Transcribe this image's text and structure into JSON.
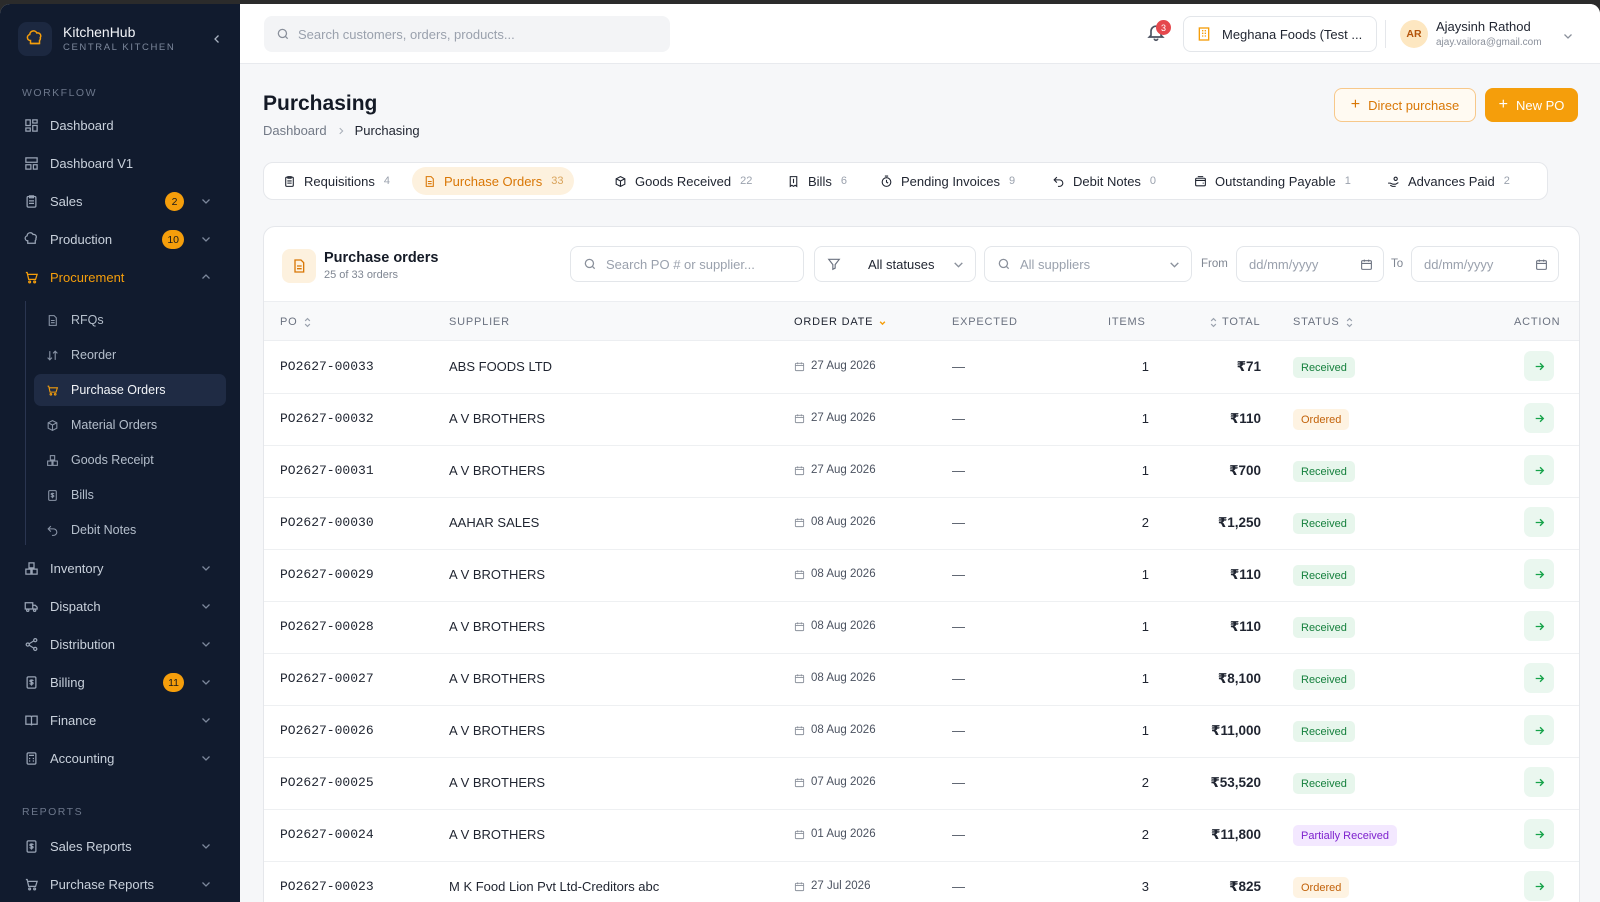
{
  "app": {
    "name": "KitchenHub",
    "subtitle": "CENTRAL KITCHEN"
  },
  "sidebar": {
    "workflow_label": "WORKFLOW",
    "reports_label": "REPORTS",
    "items": [
      {
        "label": "Dashboard",
        "icon": "grid-icon"
      },
      {
        "label": "Dashboard V1",
        "icon": "layout-icon"
      },
      {
        "label": "Sales",
        "icon": "clipboard-icon",
        "badge": "2"
      },
      {
        "label": "Production",
        "icon": "chef-hat-icon",
        "badge": "10"
      },
      {
        "label": "Procurement",
        "icon": "cart-icon",
        "active": true
      },
      {
        "label": "Inventory",
        "icon": "boxes-icon"
      },
      {
        "label": "Dispatch",
        "icon": "truck-icon"
      },
      {
        "label": "Distribution",
        "icon": "share-icon"
      },
      {
        "label": "Billing",
        "icon": "dollar-doc-icon",
        "badge": "11"
      },
      {
        "label": "Finance",
        "icon": "book-icon"
      },
      {
        "label": "Accounting",
        "icon": "calculator-icon"
      }
    ],
    "procurement_sub": [
      {
        "label": "RFQs",
        "icon": "doc-icon"
      },
      {
        "label": "Reorder",
        "icon": "sort-icon"
      },
      {
        "label": "Purchase Orders",
        "icon": "cart-icon",
        "active": true
      },
      {
        "label": "Material Orders",
        "icon": "package-icon"
      },
      {
        "label": "Goods Receipt",
        "icon": "boxes-icon"
      },
      {
        "label": "Bills",
        "icon": "dollar-doc-icon"
      },
      {
        "label": "Debit Notes",
        "icon": "undo-icon"
      }
    ],
    "reports": [
      {
        "label": "Sales Reports",
        "icon": "dollar-doc-icon"
      },
      {
        "label": "Purchase Reports",
        "icon": "cart-icon"
      }
    ]
  },
  "topbar": {
    "search_placeholder": "Search customers, orders, products...",
    "notifications": "3",
    "org": "Meghana Foods (Test ...",
    "user_initials": "AR",
    "user_name": "Ajaysinh Rathod",
    "user_email": "ajay.vailora@gmail.com"
  },
  "header": {
    "title": "Purchasing",
    "breadcrumb": [
      "Dashboard",
      "Purchasing"
    ],
    "direct_purchase": "Direct purchase",
    "new_po": "New PO"
  },
  "tabs": [
    {
      "label": "Requisitions",
      "count": "4",
      "icon": "clipboard-icon"
    },
    {
      "label": "Purchase Orders",
      "count": "33",
      "icon": "doc-icon",
      "active": true
    },
    {
      "label": "Goods Received",
      "count": "22",
      "icon": "package-icon"
    },
    {
      "label": "Bills",
      "count": "6",
      "icon": "receipt-icon"
    },
    {
      "label": "Pending Invoices",
      "count": "9",
      "icon": "hourglass-icon"
    },
    {
      "label": "Debit Notes",
      "count": "0",
      "icon": "undo-icon"
    },
    {
      "label": "Outstanding Payable",
      "count": "1",
      "icon": "wallet-icon"
    },
    {
      "label": "Advances Paid",
      "count": "2",
      "icon": "hand-coins-icon"
    }
  ],
  "card": {
    "title": "Purchase orders",
    "subtitle": "25 of 33 orders",
    "search_placeholder": "Search PO # or supplier...",
    "status_filter": "All statuses",
    "supplier_placeholder": "All suppliers",
    "from_label": "From",
    "to_label": "To",
    "date_placeholder": "dd/mm/yyyy"
  },
  "table": {
    "columns": [
      "PO",
      "SUPPLIER",
      "ORDER DATE",
      "EXPECTED",
      "ITEMS",
      "TOTAL",
      "STATUS",
      "ACTION"
    ],
    "rows": [
      {
        "po": "PO2627-00033",
        "supplier": "ABS FOODS LTD",
        "date": "27 Aug 2026",
        "expected": "—",
        "items": "1",
        "total": "₹71",
        "status": "Received",
        "kind": "received"
      },
      {
        "po": "PO2627-00032",
        "supplier": "A V BROTHERS",
        "date": "27 Aug 2026",
        "expected": "—",
        "items": "1",
        "total": "₹110",
        "status": "Ordered",
        "kind": "ordered"
      },
      {
        "po": "PO2627-00031",
        "supplier": "A V BROTHERS",
        "date": "27 Aug 2026",
        "expected": "—",
        "items": "1",
        "total": "₹700",
        "status": "Received",
        "kind": "received"
      },
      {
        "po": "PO2627-00030",
        "supplier": "AAHAR SALES",
        "date": "08 Aug 2026",
        "expected": "—",
        "items": "2",
        "total": "₹1,250",
        "status": "Received",
        "kind": "received"
      },
      {
        "po": "PO2627-00029",
        "supplier": "A V BROTHERS",
        "date": "08 Aug 2026",
        "expected": "—",
        "items": "1",
        "total": "₹110",
        "status": "Received",
        "kind": "received"
      },
      {
        "po": "PO2627-00028",
        "supplier": "A V BROTHERS",
        "date": "08 Aug 2026",
        "expected": "—",
        "items": "1",
        "total": "₹110",
        "status": "Received",
        "kind": "received"
      },
      {
        "po": "PO2627-00027",
        "supplier": "A V BROTHERS",
        "date": "08 Aug 2026",
        "expected": "—",
        "items": "1",
        "total": "₹8,100",
        "status": "Received",
        "kind": "received"
      },
      {
        "po": "PO2627-00026",
        "supplier": "A V BROTHERS",
        "date": "08 Aug 2026",
        "expected": "—",
        "items": "1",
        "total": "₹11,000",
        "status": "Received",
        "kind": "received"
      },
      {
        "po": "PO2627-00025",
        "supplier": "A V BROTHERS",
        "date": "07 Aug 2026",
        "expected": "—",
        "items": "2",
        "total": "₹53,520",
        "status": "Received",
        "kind": "received"
      },
      {
        "po": "PO2627-00024",
        "supplier": "A V BROTHERS",
        "date": "01 Aug 2026",
        "expected": "—",
        "items": "2",
        "total": "₹11,800",
        "status": "Partially Received",
        "kind": "partial"
      },
      {
        "po": "PO2627-00023",
        "supplier": "M K Food Lion Pvt Ltd-Creditors abc",
        "date": "27 Jul 2026",
        "expected": "—",
        "items": "3",
        "total": "₹825",
        "status": "Ordered",
        "kind": "ordered"
      }
    ]
  },
  "colors": {
    "accent": "#f59e0b",
    "sidebar_bg": "#111b2e",
    "received": "#15803d",
    "ordered": "#c2620a",
    "partial": "#7e22ce"
  }
}
